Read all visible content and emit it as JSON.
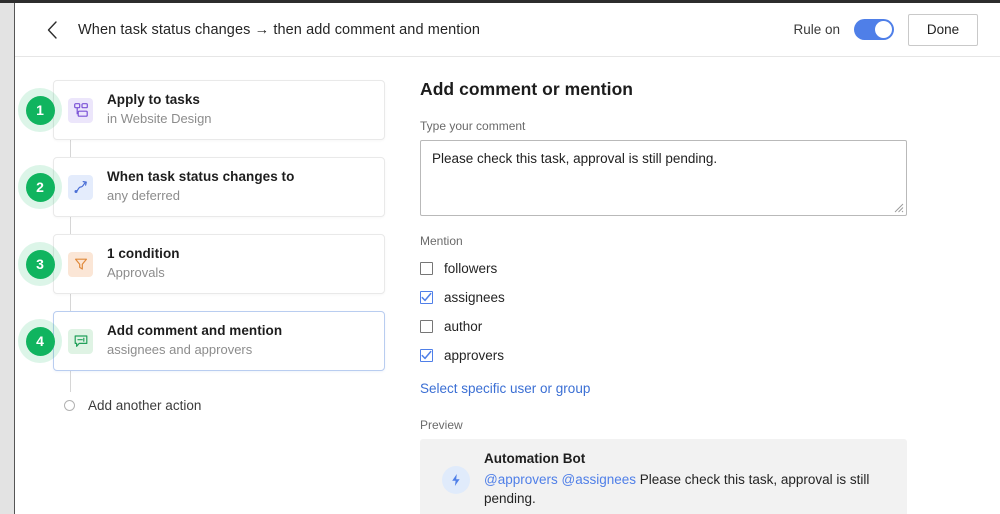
{
  "header": {
    "back_icon": "chevron-left-icon",
    "title": "When task status changes → then add comment and mention",
    "rule_label": "Rule on",
    "rule_enabled": true,
    "done_label": "Done",
    "accent_blue": "#4f7fe8"
  },
  "flow": {
    "badge_color": "#10b45f",
    "steps": [
      {
        "number": "1",
        "icon": "apply-to-tasks-icon",
        "title": "Apply to tasks",
        "subtitle": "in Website Design",
        "selected": false
      },
      {
        "number": "2",
        "icon": "trigger-status-icon",
        "title": "When task status changes to",
        "subtitle": "any deferred",
        "selected": false
      },
      {
        "number": "3",
        "icon": "filter-condition-icon",
        "title": "1 condition",
        "subtitle": "Approvals",
        "selected": false
      },
      {
        "number": "4",
        "icon": "comment-mention-icon",
        "title": "Add comment and mention",
        "subtitle": "assignees and approvers",
        "selected": true
      }
    ],
    "add_another": "Add another action"
  },
  "detail": {
    "title": "Add comment or mention",
    "comment_label": "Type your comment",
    "comment_value": "Please check this task, approval is still pending.",
    "comment_placeholder": "Type your comment",
    "mention_label": "Mention",
    "mention_options": [
      {
        "label": "followers",
        "checked": false
      },
      {
        "label": "assignees",
        "checked": true
      },
      {
        "label": "author",
        "checked": false
      },
      {
        "label": "approvers",
        "checked": true
      }
    ],
    "select_link": "Select specific user or group",
    "preview_label": "Preview",
    "preview": {
      "avatar_icon": "lightning-bolt-icon",
      "bot_name": "Automation Bot",
      "mention_1": "@approvers",
      "mention_2": "@assignees",
      "message": "Please check this task, approval is still pending."
    }
  }
}
